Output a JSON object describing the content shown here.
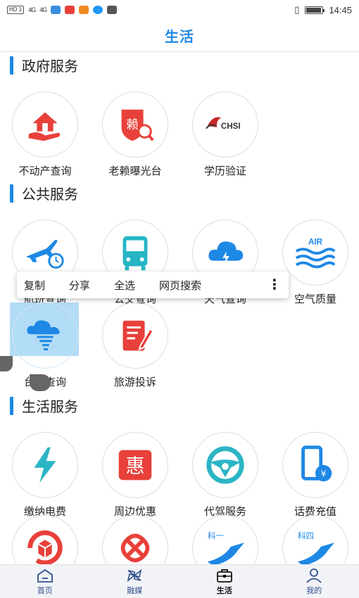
{
  "status_bar": {
    "left_chips": [
      "HD 1",
      "HD 2"
    ],
    "signal_1": "4G",
    "signal_2": "4G",
    "time": "14:45",
    "battery_level": 0.9
  },
  "header": {
    "title": "生活"
  },
  "sections": {
    "government": {
      "title": "政府服务",
      "items": [
        {
          "label": "不动产查询",
          "icon": "house-hand-icon",
          "color": "#e8403a"
        },
        {
          "label": "老赖曝光台",
          "icon": "lai-shield-icon",
          "color": "#e8403a"
        },
        {
          "label": "学历验证",
          "icon": "chsi-logo-icon",
          "color": "#c62828",
          "logo_text": "CHSI"
        }
      ]
    },
    "public": {
      "title": "公共服务",
      "items": [
        {
          "label": "航班查询",
          "icon": "airplane-clock-icon",
          "color": "#1e88e5"
        },
        {
          "label": "公交查询",
          "icon": "bus-icon",
          "color": "#26b5c5"
        },
        {
          "label": "天气查询",
          "icon": "cloud-lightning-icon",
          "color": "#1e88e5"
        },
        {
          "label": "空气质量",
          "icon": "air-waves-icon",
          "color": "#1e88e5",
          "logo_text": "AIR"
        },
        {
          "label": "台风查询",
          "icon": "typhoon-cloud-icon",
          "color": "#1e88e5"
        },
        {
          "label": "旅游投诉",
          "icon": "notepad-pen-icon",
          "color": "#e8403a"
        }
      ]
    },
    "life": {
      "title": "生活服务",
      "items": [
        {
          "label": "缴纳电费",
          "icon": "lightning-icon",
          "color": "#2bb5c5"
        },
        {
          "label": "周边优惠",
          "icon": "hui-badge-icon",
          "color": "#e8403a",
          "logo_text": "惠"
        },
        {
          "label": "代驾服务",
          "icon": "steering-wheel-icon",
          "color": "#2bb5c5"
        },
        {
          "label": "话费充值",
          "icon": "phone-yuan-icon",
          "color": "#1e88e5"
        },
        {
          "label": "",
          "icon": "box-refresh-icon",
          "color": "#e8403a"
        },
        {
          "label": "",
          "icon": "china-unicom-icon",
          "color": "#e8403a"
        },
        {
          "label": "",
          "icon": "road-ke1-icon",
          "color": "#1e88e5",
          "logo_text": "科一"
        },
        {
          "label": "",
          "icon": "road-ke4-icon",
          "color": "#1e88e5",
          "logo_text": "科四"
        }
      ]
    }
  },
  "context_menu": {
    "items": [
      "复制",
      "分享",
      "全选",
      "网页搜索"
    ],
    "more_icon": "more-vertical-icon"
  },
  "tab_bar": {
    "tabs": [
      {
        "label": "首页",
        "icon": "home-icon"
      },
      {
        "label": "融媒",
        "icon": "pinwheel-icon"
      },
      {
        "label": "生活",
        "icon": "briefcase-icon",
        "active": true
      },
      {
        "label": "我的",
        "icon": "user-icon"
      }
    ]
  },
  "colors": {
    "accent": "#1e88e5",
    "selection": "#b3dcf7"
  }
}
